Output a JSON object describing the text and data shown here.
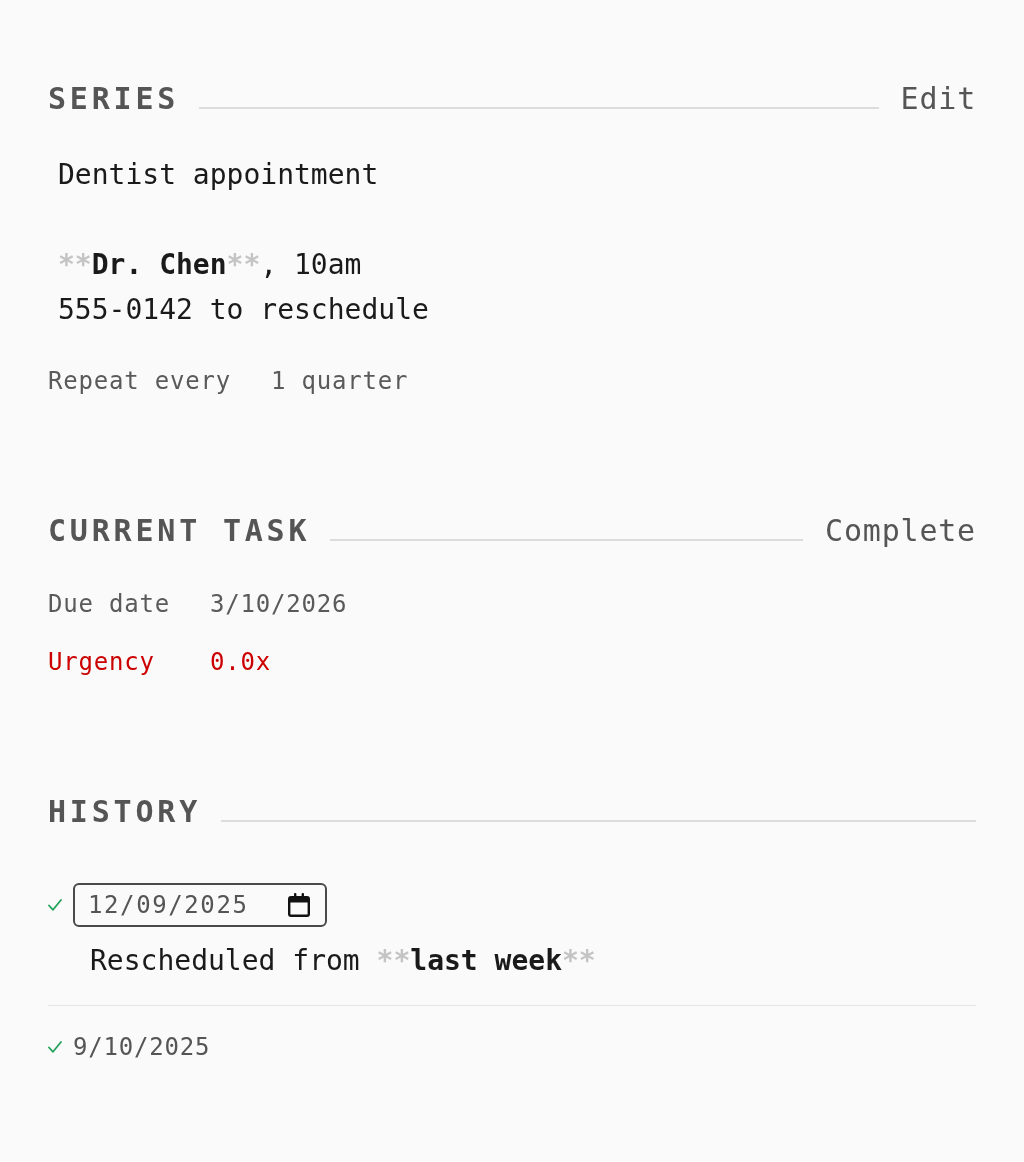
{
  "series": {
    "heading": "SERIES",
    "action": "Edit",
    "title": "Dentist appointment",
    "notes": [
      {
        "segments": [
          {
            "kind": "marker",
            "text": "**"
          },
          {
            "kind": "bold",
            "text": "Dr. Chen"
          },
          {
            "kind": "marker",
            "text": "**"
          },
          {
            "kind": "plain",
            "text": ", 10am"
          }
        ]
      },
      {
        "segments": [
          {
            "kind": "plain",
            "text": "555-0142 to reschedule"
          }
        ]
      }
    ],
    "repeat": {
      "label": "Repeat every",
      "value": "1 quarter"
    }
  },
  "current_task": {
    "heading": "CURRENT TASK",
    "action": "Complete",
    "fields": [
      {
        "label": "Due date",
        "value": "3/10/2026",
        "alert": false
      },
      {
        "label": "Urgency",
        "value": "0.0x",
        "alert": true
      }
    ]
  },
  "history": {
    "heading": "HISTORY",
    "entries": [
      {
        "date": "12/09/2025",
        "done": true,
        "editing": true,
        "note": [
          {
            "kind": "plain",
            "text": "Rescheduled from "
          },
          {
            "kind": "marker",
            "text": "**"
          },
          {
            "kind": "bold",
            "text": "last week"
          },
          {
            "kind": "marker",
            "text": "**"
          }
        ]
      },
      {
        "date": "9/10/2025",
        "done": true,
        "editing": false
      }
    ]
  }
}
